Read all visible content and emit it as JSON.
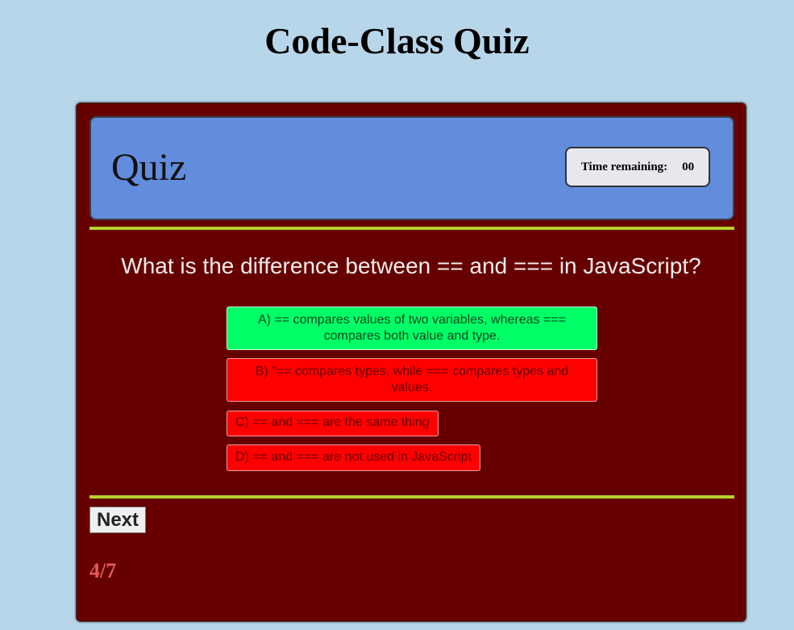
{
  "page_title": "Code-Class Quiz",
  "header": {
    "title": "Quiz",
    "timer_label": "Time remaining:",
    "timer_value": "00"
  },
  "question": "What is the difference between == and === in JavaScript?",
  "options": [
    {
      "label": "A) == compares values of two variables, whereas === compares both value and type.",
      "state": "correct"
    },
    {
      "label": "B) \"== compares types, while === compares types and values.",
      "state": "wrong"
    },
    {
      "label": "C) == and === are the same thing",
      "state": "wrong"
    },
    {
      "label": "D) == and === are not used in JavaScript",
      "state": "wrong"
    }
  ],
  "next_label": "Next",
  "progress": "4/7"
}
